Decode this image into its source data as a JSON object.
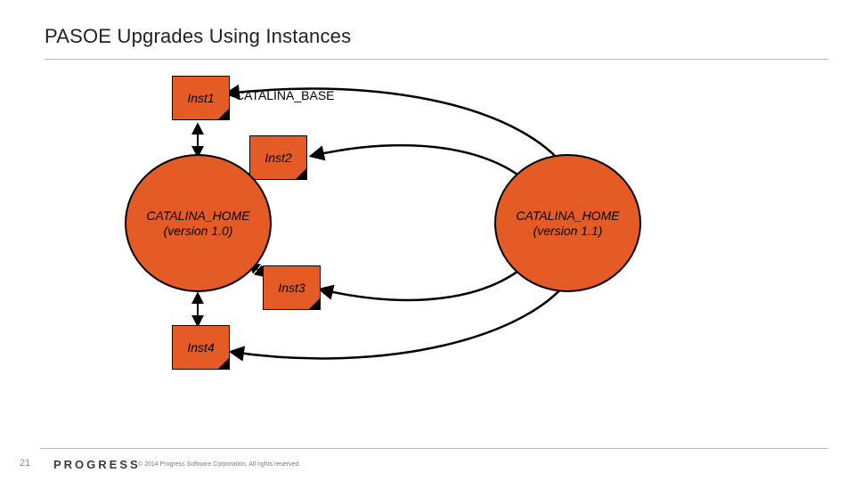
{
  "slide": {
    "title": "PASOE Upgrades Using Instances",
    "catalina_base_label": "CATALINA_BASE",
    "instances": {
      "inst1": "Inst1",
      "inst2": "Inst2",
      "inst3": "Inst3",
      "inst4": "Inst4"
    },
    "homes": {
      "left_line1": "CATALINA_HOME",
      "left_line2": "(version 1.0)",
      "right_line1": "CATALINA_HOME",
      "right_line2": "(version 1.1)"
    },
    "page_number": "21",
    "brand": "PROGRESS",
    "copyright": "© 2014 Progress Software Corporation. All rights reserved."
  }
}
